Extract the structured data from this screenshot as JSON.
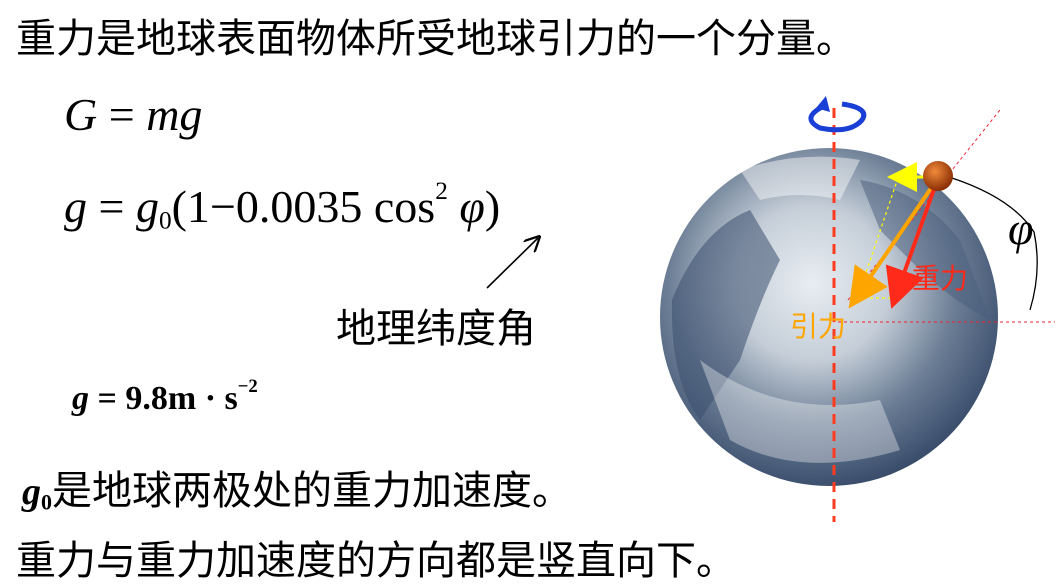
{
  "header": {
    "text": "重力是地球表面物体所受地球引力的一个分量。"
  },
  "formula1": {
    "lhs": "G",
    "eq": "=",
    "rhs": "mg"
  },
  "formula2": {
    "lhs": "g",
    "eq": "=",
    "g0_base": "g",
    "g0_sub": "0",
    "open": "(1",
    "minus": "−",
    "coef": "0.0035",
    "cos": "cos",
    "exp": "2",
    "phi": "φ",
    "close": ")"
  },
  "latitude_label": "地理纬度角",
  "gvalue": {
    "g": "g",
    "eq": "=",
    "value": "9.8m · s",
    "exp": "−2"
  },
  "g0_line": {
    "sym": "g",
    "sub": "0",
    "text": "是地球两极处的重力加速度。"
  },
  "footer": {
    "text": "重力与重力加速度的方向都是竖直向下。"
  },
  "diagram": {
    "gravity_label": "重力",
    "attraction_label": "引力",
    "angle_label": "φ",
    "colors": {
      "axis": "#ff3b1f",
      "gravity": "#ff2a1a",
      "attraction": "#ffa500",
      "centripetal": "#ffff00",
      "rotation": "#1a3fd6",
      "mass": "#b84a0a"
    }
  }
}
